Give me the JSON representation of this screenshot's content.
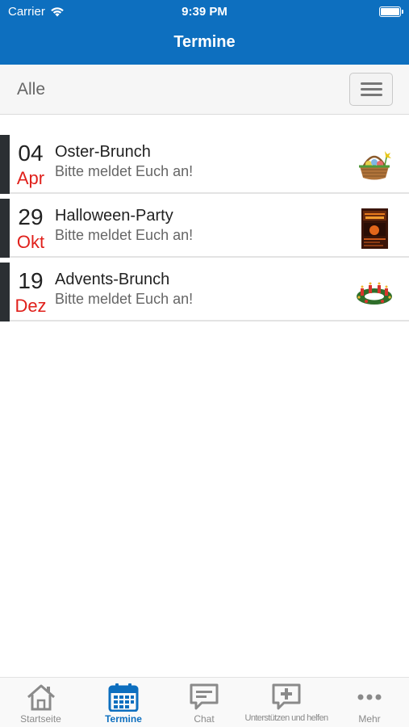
{
  "status": {
    "carrier": "Carrier",
    "time": "9:39 PM"
  },
  "nav": {
    "title": "Termine"
  },
  "filter": {
    "label": "Alle"
  },
  "events": [
    {
      "day": "04",
      "month": "Apr",
      "title": "Oster-Brunch",
      "subtitle": "Bitte meldet Euch an!",
      "icon": "easter-basket"
    },
    {
      "day": "29",
      "month": "Okt",
      "title": "Halloween-Party",
      "subtitle": "Bitte meldet Euch an!",
      "icon": "halloween-poster"
    },
    {
      "day": "19",
      "month": "Dez",
      "title": "Advents-Brunch",
      "subtitle": "Bitte meldet Euch an!",
      "icon": "advent-wreath"
    }
  ],
  "tabs": [
    {
      "label": "Startseite",
      "icon": "home-icon"
    },
    {
      "label": "Termine",
      "icon": "calendar-icon",
      "active": true
    },
    {
      "label": "Chat",
      "icon": "chat-icon"
    },
    {
      "label": "Unterstützen und helfen",
      "icon": "support-chat-icon"
    },
    {
      "label": "Mehr",
      "icon": "more-icon"
    }
  ],
  "colors": {
    "primary": "#0d6fbf",
    "accent_month": "#e0201b",
    "date_bar": "#2b2f33"
  }
}
